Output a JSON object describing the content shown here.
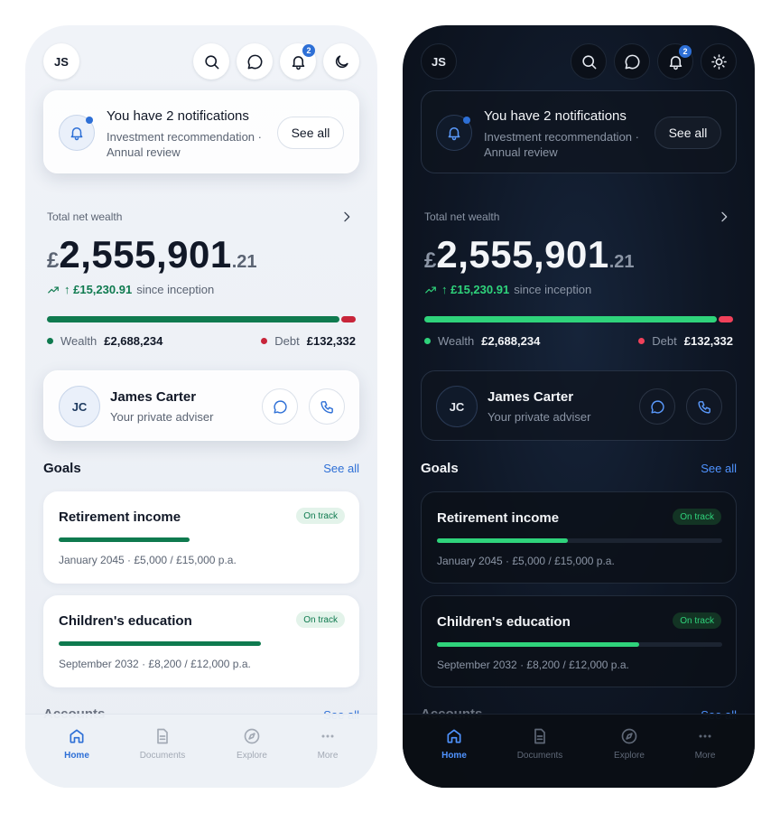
{
  "user": {
    "initials": "JS"
  },
  "notifications": {
    "count": "2",
    "title": "You have 2 notifications",
    "subtitle": "Investment recommendation · Annual review",
    "button": "See all"
  },
  "net_wealth": {
    "label": "Total net wealth",
    "currency": "£",
    "main": "2,555,901",
    "decimal": ".21",
    "change_amount": "↑ £15,230.91",
    "change_label": "since inception",
    "wealth_label": "Wealth",
    "wealth_value": "£2,688,234",
    "debt_label": "Debt",
    "debt_value": "£132,332"
  },
  "adviser": {
    "initials": "JC",
    "name": "James Carter",
    "role": "Your private adviser"
  },
  "goals": {
    "title": "Goals",
    "link": "See all",
    "items": [
      {
        "title": "Retirement income",
        "status": "On track",
        "progress": 0.46,
        "meta": "January 2045 · £5,000 / £15,000 p.a."
      },
      {
        "title": "Children's education",
        "status": "On track",
        "progress": 0.71,
        "meta": "September 2032 · £8,200 / £12,000 p.a."
      }
    ]
  },
  "accounts": {
    "title": "Accounts",
    "link": "See all"
  },
  "nav": {
    "home": "Home",
    "documents": "Documents",
    "explore": "Explore",
    "more": "More"
  },
  "colors": {
    "light_accent": "#2d6fd6",
    "light_positive": "#0f7a4f",
    "light_negative": "#c8253a",
    "dark_accent": "#4f93ff",
    "dark_positive": "#2fd37b",
    "dark_negative": "#f0415a"
  },
  "icons": {
    "search": "search-icon",
    "chat": "chat-bubble-icon",
    "bell": "bell-icon",
    "theme_light_screen": "moon-icon",
    "theme_dark_screen": "sun-icon",
    "phone": "phone-icon"
  }
}
